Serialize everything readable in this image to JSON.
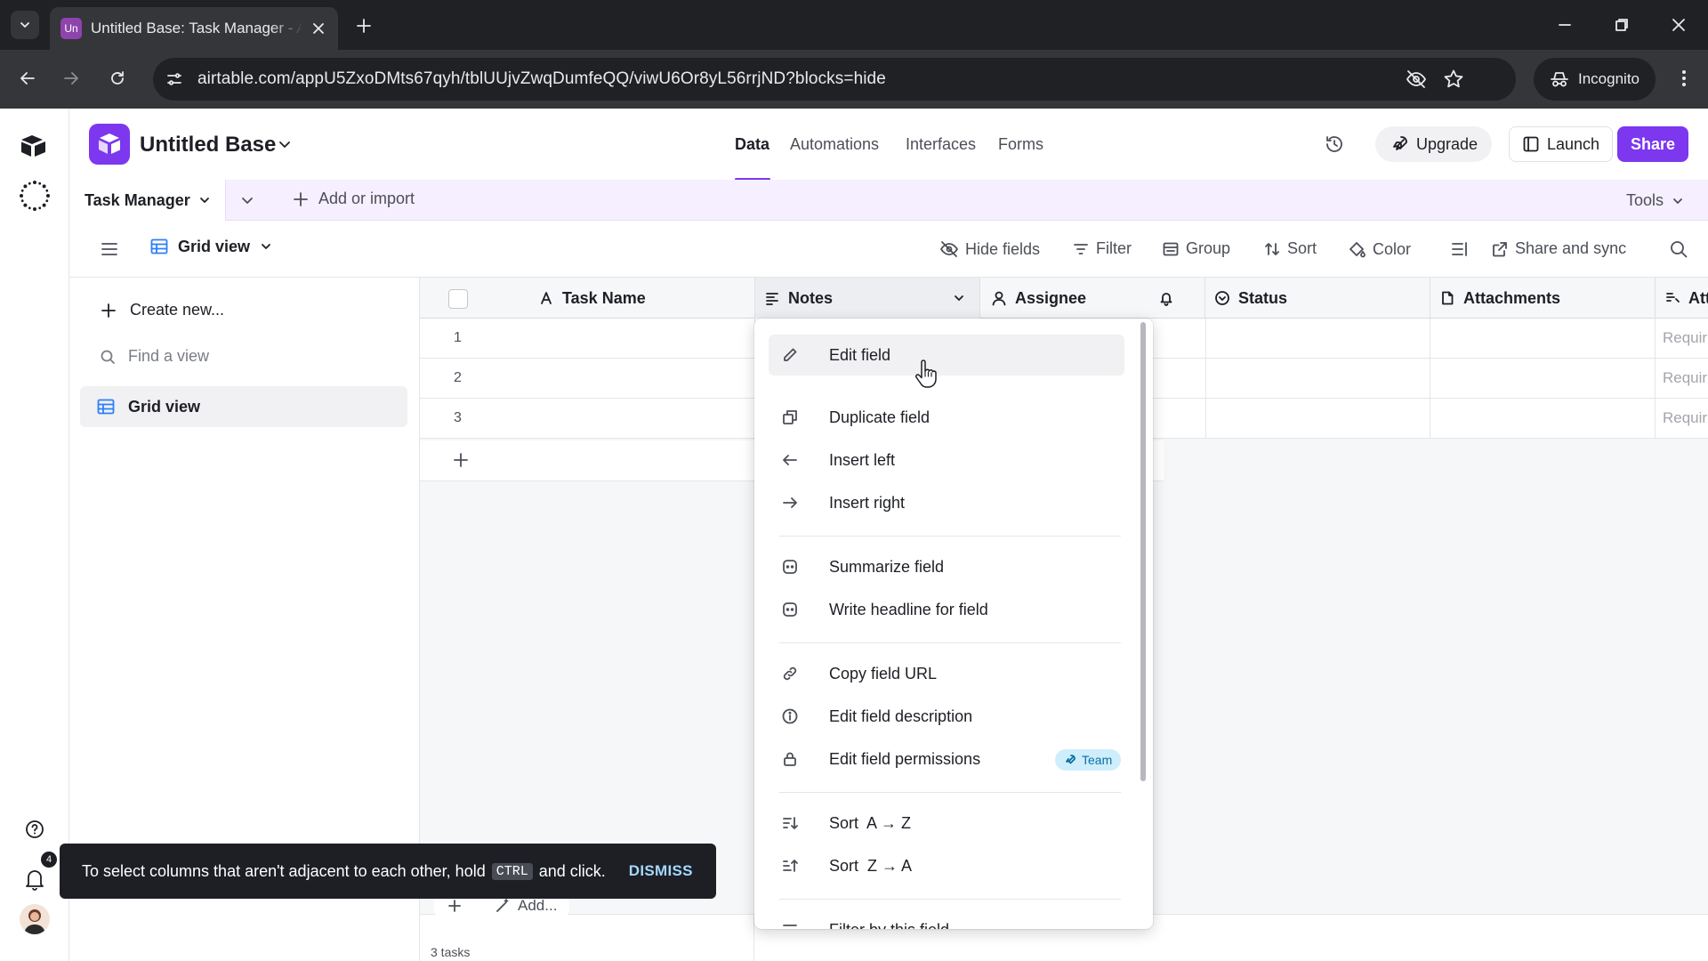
{
  "browser": {
    "tab_favicon": "Un",
    "tab_title": "Untitled Base: Task Manager - Airtable",
    "url": "airtable.com/appU5ZxoDMts67qyh/tblUUjvZwqDumfeQQ/viwU6Or8yL56rrjND?blocks=hide",
    "incognito_label": "Incognito"
  },
  "base": {
    "title": "Untitled Base",
    "brand_color": "#7c37ef",
    "nav_tabs": [
      "Data",
      "Automations",
      "Interfaces",
      "Forms"
    ],
    "active_tab": "Data",
    "upgrade_label": "Upgrade",
    "launch_label": "Launch",
    "share_label": "Share"
  },
  "tables": {
    "current": "Task Manager",
    "add_import": "Add or import",
    "tools": "Tools"
  },
  "viewbar": {
    "view_name": "Grid view",
    "hide_fields": "Hide fields",
    "filter": "Filter",
    "group": "Group",
    "sort": "Sort",
    "color": "Color",
    "share_sync": "Share and sync"
  },
  "sidebar": {
    "create_new": "Create new...",
    "find_view": "Find a view",
    "views": [
      "Grid view"
    ]
  },
  "grid": {
    "columns": [
      "Task Name",
      "Notes",
      "Assignee",
      "Status",
      "Attachments",
      "Att"
    ],
    "rows": [
      "1",
      "2",
      "3"
    ],
    "required_placeholder": "Requir",
    "footer_count": "3 tasks",
    "footer_add": "Add..."
  },
  "menu": {
    "items": [
      {
        "label": "Edit field",
        "icon": "pencil-icon"
      },
      {
        "label": "Duplicate field",
        "icon": "duplicate-icon"
      },
      {
        "label": "Insert left",
        "icon": "arrow-left-icon"
      },
      {
        "label": "Insert right",
        "icon": "arrow-right-icon"
      },
      {
        "label": "Summarize field",
        "icon": "ai-icon"
      },
      {
        "label": "Write headline for field",
        "icon": "ai-icon"
      },
      {
        "label": "Copy field URL",
        "icon": "link-icon"
      },
      {
        "label": "Edit field description",
        "icon": "info-icon"
      },
      {
        "label": "Edit field permissions",
        "icon": "lock-icon"
      },
      {
        "label": "Sort  A → Z",
        "icon": "sort-asc-icon"
      },
      {
        "label": "Sort  Z → A",
        "icon": "sort-desc-icon"
      },
      {
        "label": "Filter by this field",
        "icon": "filter-icon"
      }
    ],
    "team_badge": "Team"
  },
  "toast": {
    "text_before": "To select columns that aren't adjacent to each other, hold",
    "key": "CTRL",
    "text_after": "and click.",
    "dismiss": "DISMISS"
  },
  "notifications_count": "4"
}
